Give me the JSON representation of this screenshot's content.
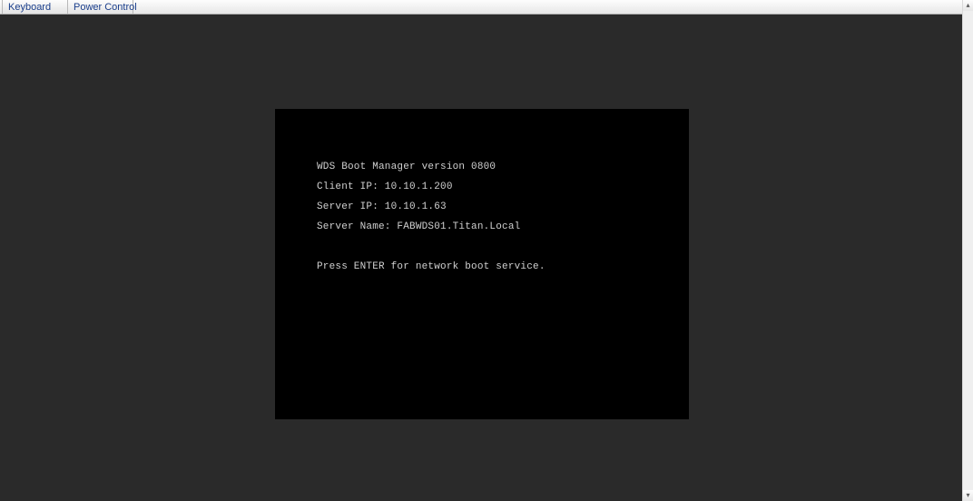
{
  "menubar": {
    "items": [
      {
        "label": "Keyboard"
      },
      {
        "label": "Power Control"
      }
    ]
  },
  "console": {
    "line1": "WDS Boot Manager version 0800",
    "line2": "Client IP: 10.10.1.200",
    "line3": "Server IP: 10.10.1.63",
    "line4": "Server Name: FABWDS01.Titan.Local",
    "line5": "Press ENTER for network boot service."
  },
  "scrollbar": {
    "up_glyph": "▴",
    "down_glyph": "▾"
  }
}
